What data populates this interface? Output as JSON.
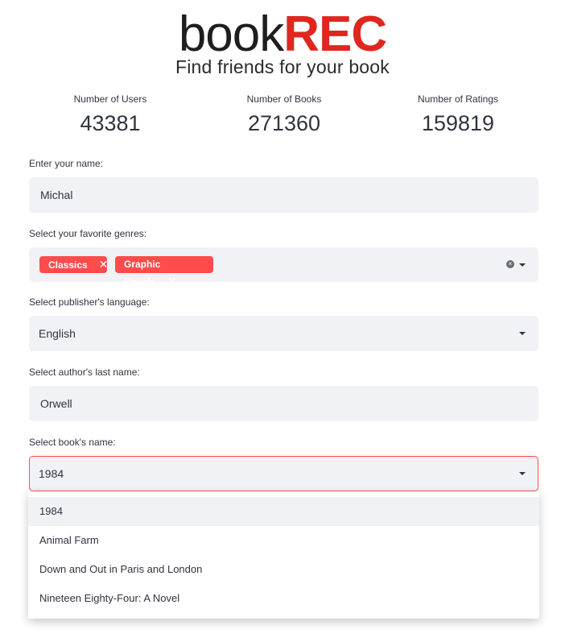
{
  "logo": {
    "word_a": "book",
    "word_b": "REC",
    "tagline": "Find friends for your book"
  },
  "metrics": [
    {
      "label": "Number of Users",
      "value": "43381"
    },
    {
      "label": "Number of Books",
      "value": "271360"
    },
    {
      "label": "Number of Ratings",
      "value": "159819"
    }
  ],
  "name_field": {
    "label": "Enter your name:",
    "value": "Michal"
  },
  "genres_field": {
    "label": "Select your favorite genres:",
    "tags": [
      "Classics",
      "Graphic Novels"
    ],
    "tag_remove": "✕"
  },
  "language_field": {
    "label": "Select publisher's language:",
    "value": "English"
  },
  "author_field": {
    "label": "Select author's last name:",
    "value": "Orwell"
  },
  "book_field": {
    "label": "Select book's name:",
    "value": "1984",
    "options": [
      "1984",
      "Animal Farm",
      "Down and Out in Paris and London",
      "Nineteen Eighty-Four: A Novel"
    ]
  },
  "colors": {
    "accent": "#ff4b4b",
    "logo_red": "#e0261f",
    "field_bg": "#f0f2f6",
    "text": "#31333f"
  }
}
